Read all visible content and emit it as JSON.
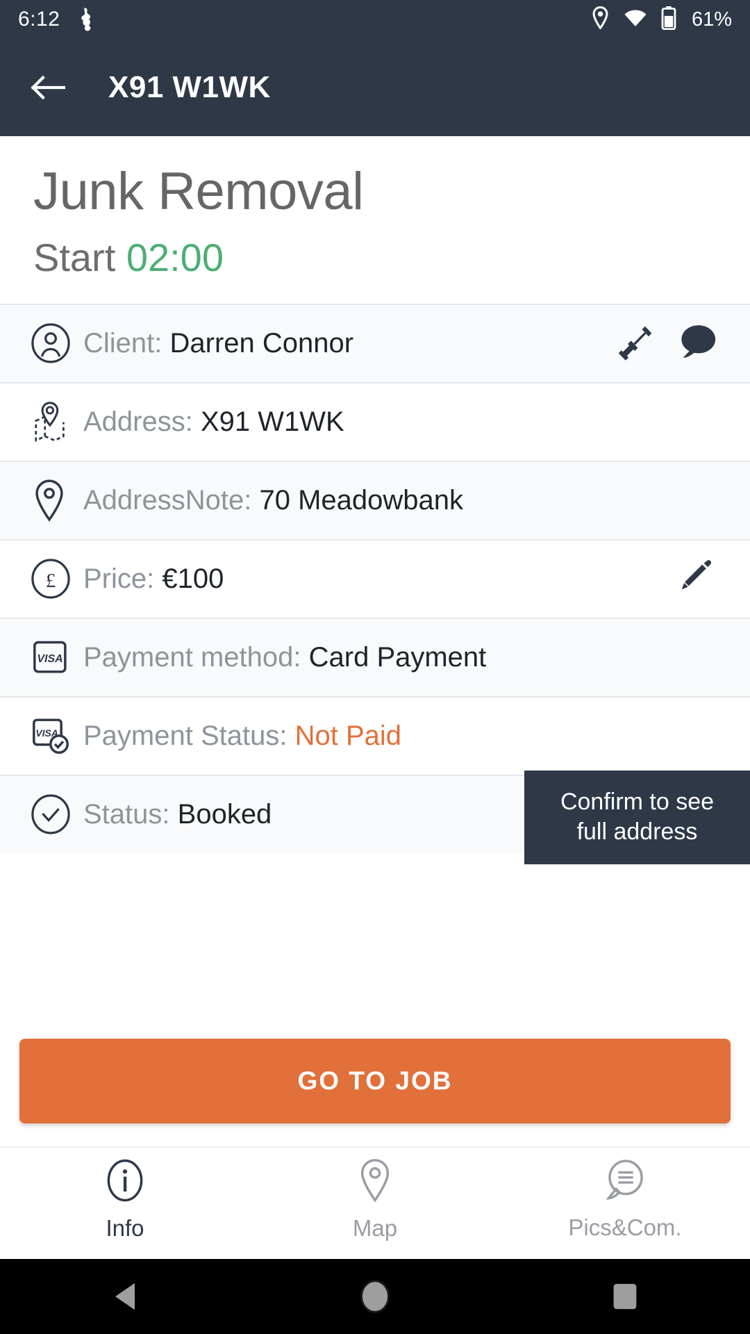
{
  "status_bar": {
    "time": "6:12",
    "battery_percent": "61%",
    "icons": [
      "app-notification-icon",
      "location-icon",
      "wifi-icon",
      "battery-icon"
    ]
  },
  "app_bar": {
    "back_icon": "arrow-left-icon",
    "title": "X91 W1WK"
  },
  "header": {
    "job_title": "Junk Removal",
    "start_label": "Start",
    "start_time": "02:00"
  },
  "tooltip": {
    "line1": "Confirm to see",
    "line2": "full address"
  },
  "rows": [
    {
      "icon": "person-circle-icon",
      "label": "Client:",
      "value": "Darren Connor",
      "actions": [
        "phone-icon",
        "chat-icon"
      ]
    },
    {
      "icon": "map-pin-map-icon",
      "label": "Address:",
      "value": "X91 W1WK",
      "actions": []
    },
    {
      "icon": "location-pin-icon",
      "label": "AddressNote:",
      "value": "70 Meadowbank",
      "actions": []
    },
    {
      "icon": "pound-circle-icon",
      "label": "Price:",
      "value": "€100",
      "actions": [
        "edit-pencil-icon"
      ]
    },
    {
      "icon": "visa-card-icon",
      "label": "Payment method:",
      "value": "Card Payment",
      "actions": []
    },
    {
      "icon": "visa-check-icon",
      "label": "Payment Status:",
      "value": "Not Paid",
      "actions": []
    },
    {
      "icon": "check-circle-icon",
      "label": "Status:",
      "value": "Booked",
      "actions": []
    }
  ],
  "cta": {
    "label": "GO TO JOB"
  },
  "tabs": [
    {
      "icon": "info-circle-icon",
      "label": "Info",
      "active": true
    },
    {
      "icon": "map-pin-icon",
      "label": "Map",
      "active": false
    },
    {
      "icon": "comment-lines-icon",
      "label": "Pics&Com.",
      "active": false
    }
  ],
  "nav_bar": {
    "items": [
      "back-triangle-icon",
      "home-circle-icon",
      "recents-square-icon"
    ]
  },
  "colors": {
    "app_bar": "#2e3847",
    "accent_orange": "#e2703a",
    "start_green": "#4caf72",
    "label_grey": "#8e949c",
    "value_dark": "#1f232b"
  }
}
